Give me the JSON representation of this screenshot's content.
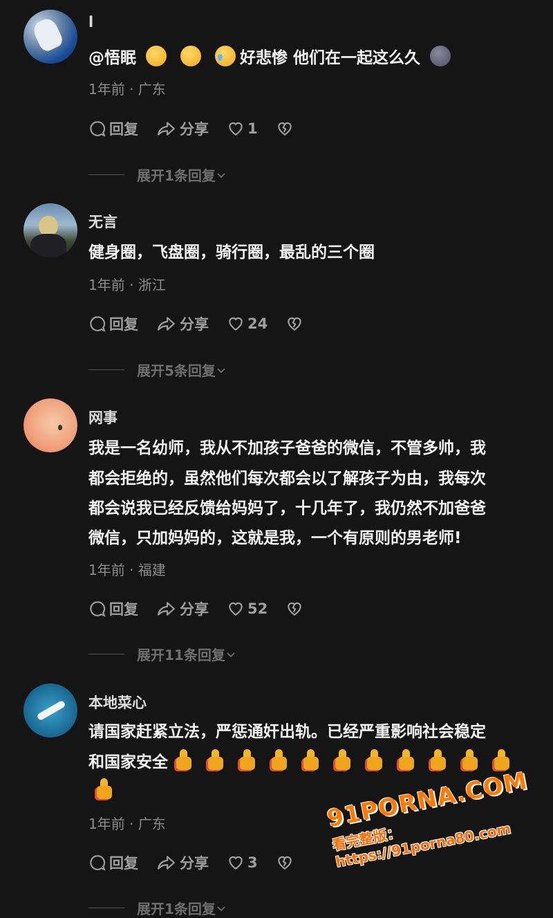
{
  "comments": [
    {
      "username": "l",
      "text_before": "@悟眠",
      "text_after": "好悲惨 他们在一起这么久",
      "meta": "1年前 · 广东",
      "reply": "回复",
      "share": "分享",
      "likes": "1",
      "expand": "展开1条回复"
    },
    {
      "username": "无言",
      "text": "健身圈，飞盘圈，骑行圈，最乱的三个圈",
      "meta": "1年前 · 浙江",
      "reply": "回复",
      "share": "分享",
      "likes": "24",
      "expand": "展开5条回复"
    },
    {
      "username": "网事",
      "lines": [
        "我是一名幼师，我从不加孩子爸爸的微信，不管多帅，我",
        "都会拒绝的，虽然他们每次都会以了解孩子为由，我每次",
        "都会说我已经反馈给妈妈了，十几年了，我仍然不加爸爸",
        "微信，只加妈妈的，这就是我，一个有原则的男老师!"
      ],
      "meta": "1年前 · 福建",
      "reply": "回复",
      "share": "分享",
      "likes": "52",
      "expand": "展开11条回复"
    },
    {
      "username": "本地菜心",
      "line1": "请国家赶紧立法，严惩通奸出轨。已经严重影响社会稳定",
      "line2": "和国家安全",
      "meta": "1年前 · 广东",
      "reply": "回复",
      "share": "分享",
      "likes": "3",
      "expand": "展开1条回复"
    }
  ],
  "watermark": {
    "logo": "91PORNA.COM",
    "sub": "看完整版：https://91porna80.com"
  },
  "colors": {
    "background": "#151515",
    "accent": "#ff7a00"
  }
}
